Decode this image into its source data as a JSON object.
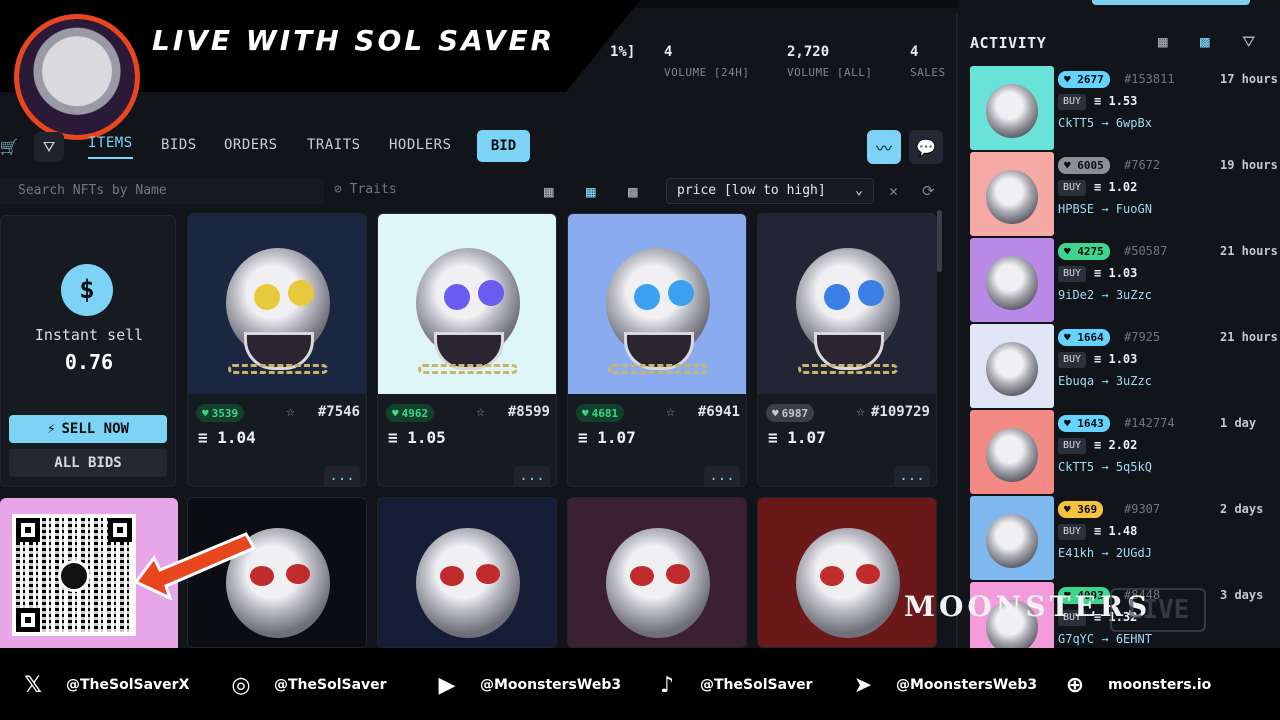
{
  "banner": {
    "title": "LIVE WITH SOL SAVER"
  },
  "stats": [
    {
      "value": "1%]",
      "label": ""
    },
    {
      "value": "4",
      "label": "VOLUME [24H]"
    },
    {
      "value": "2,720",
      "label": "VOLUME [ALL]"
    },
    {
      "value": "4",
      "label": "SALES"
    }
  ],
  "tabs": [
    "ITEMS",
    "BIDS",
    "ORDERS",
    "TRAITS",
    "HODLERS",
    "BID"
  ],
  "search": {
    "placeholder": "Search NFTs by Name",
    "traits": "Traits"
  },
  "sort": {
    "selected": "price [low to high]"
  },
  "sell": {
    "label": "Instant sell",
    "value": "0.76",
    "sell_button": "SELL NOW",
    "all_bids": "ALL BIDS"
  },
  "items": [
    {
      "rank": "3539",
      "id": "#7546",
      "price": "1.04",
      "bg": "#1b2740",
      "badge": "green"
    },
    {
      "rank": "4962",
      "id": "#8599",
      "price": "1.05",
      "bg": "#dff6f8",
      "badge": "green"
    },
    {
      "rank": "4681",
      "id": "#6941",
      "price": "1.07",
      "bg": "#8aabef",
      "badge": "green"
    },
    {
      "rank": "6987",
      "id": "#109729",
      "price": "1.07",
      "bg": "#222634",
      "badge": "gray"
    }
  ],
  "row2_bgs": [
    "#0b0d12",
    "#161d36",
    "#3b2030",
    "#6a1818"
  ],
  "more_label": "...",
  "activity": {
    "title": "ACTIVITY",
    "rows": [
      {
        "rank": "2677",
        "id": "#153811",
        "time": "17 hours",
        "type": "BUY",
        "price": "1.53",
        "from": "CkTT5",
        "to": "6wpBx",
        "color": "#64d3ff",
        "thumb": "#69e3d8"
      },
      {
        "rank": "6005",
        "id": "#7672",
        "time": "19 hours",
        "type": "BUY",
        "price": "1.02",
        "from": "HPBSE",
        "to": "FuoGN",
        "color": "#8a8f98",
        "thumb": "#f5a9a4"
      },
      {
        "rank": "4275",
        "id": "#50587",
        "time": "21 hours",
        "type": "BUY",
        "price": "1.03",
        "from": "9iDe2",
        "to": "3uZzc",
        "color": "#3dd68c",
        "thumb": "#b889e6"
      },
      {
        "rank": "1664",
        "id": "#7925",
        "time": "21 hours",
        "type": "BUY",
        "price": "1.03",
        "from": "Ebuqa",
        "to": "3uZzc",
        "color": "#64d3ff",
        "thumb": "#dfe4f6"
      },
      {
        "rank": "1643",
        "id": "#142774",
        "time": "1 day",
        "type": "BUY",
        "price": "2.02",
        "from": "CkTT5",
        "to": "5q5kQ",
        "color": "#64d3ff",
        "thumb": "#f38a86"
      },
      {
        "rank": "369",
        "id": "#9307",
        "time": "2 days",
        "type": "BUY",
        "price": "1.48",
        "from": "E41kh",
        "to": "2UGdJ",
        "color": "#f7c23e",
        "thumb": "#7fb8ee"
      },
      {
        "rank": "4093",
        "id": "#8448",
        "time": "3 days",
        "type": "BUY",
        "price": "1.32",
        "from": "G7qYC",
        "to": "6EHNT",
        "color": "#3dd68c",
        "thumb": "#f49bdc"
      }
    ]
  },
  "watermark": "MOONSTERS",
  "live_badge": "LIVE",
  "footer": [
    {
      "icon": "x-icon",
      "glyph": "𝕏",
      "handle": "@TheSolSaverX"
    },
    {
      "icon": "instagram-icon",
      "glyph": "◎",
      "handle": "@TheSolSaver"
    },
    {
      "icon": "youtube-icon",
      "glyph": "▶",
      "handle": "@MoonstersWeb3"
    },
    {
      "icon": "tiktok-icon",
      "glyph": "♪",
      "handle": "@TheSolSaver"
    },
    {
      "icon": "telegram-icon",
      "glyph": "➤",
      "handle": "@MoonstersWeb3"
    },
    {
      "icon": "globe-icon",
      "glyph": "⊕",
      "handle": "moonsters.io"
    }
  ],
  "colors": {
    "accent": "#7dd3f5",
    "panel": "#161a21",
    "bg": "#111419",
    "banner_red": "#e8461e"
  }
}
